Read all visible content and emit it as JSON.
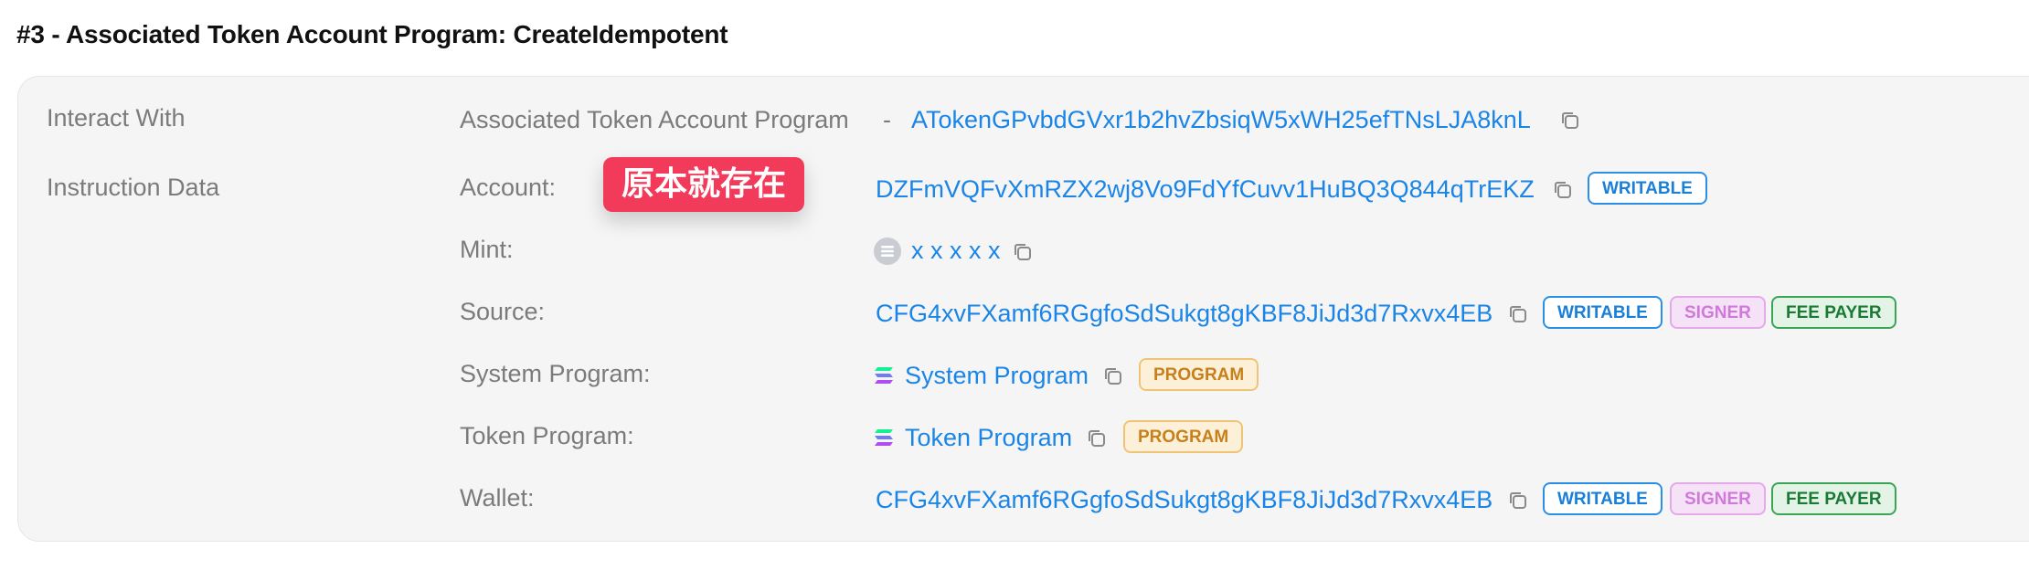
{
  "title": "#3 - Associated Token Account Program: CreateIdempotent",
  "interact_with": {
    "label": "Interact With",
    "program_name": "Associated Token Account Program",
    "separator": "-",
    "program_address": "ATokenGPvbdGVxr1b2hvZbsiqW5xWH25efTNsLJA8knL"
  },
  "instruction_data": {
    "label": "Instruction Data",
    "rows": [
      {
        "label": "Account:",
        "value": "DZFmVQFvXmRZX2wj8Vo9FdYfCuvv1HuBQ3Q844qTrEKZ",
        "badges": [
          "WRITABLE"
        ]
      },
      {
        "label": "Mint:",
        "value": "x x x x x",
        "badges": []
      },
      {
        "label": "Source:",
        "value": "CFG4xvFXamf6RGgfoSdSukgt8gKBF8JiJd3d7Rxvx4EB",
        "badges": [
          "WRITABLE",
          "SIGNER",
          "FEE PAYER"
        ]
      },
      {
        "label": "System Program:",
        "value": "System Program",
        "badges": [
          "PROGRAM"
        ]
      },
      {
        "label": "Token Program:",
        "value": "Token Program",
        "badges": [
          "PROGRAM"
        ]
      },
      {
        "label": "Wallet:",
        "value": "CFG4xvFXamf6RGgfoSdSukgt8gKBF8JiJd3d7Rxvx4EB",
        "badges": [
          "WRITABLE",
          "SIGNER",
          "FEE PAYER"
        ]
      }
    ]
  },
  "toast": "原本就存在",
  "colors": {
    "link": "#1a85e6",
    "toast": "#f23b5b",
    "card_bg": "#f5f5f5"
  }
}
